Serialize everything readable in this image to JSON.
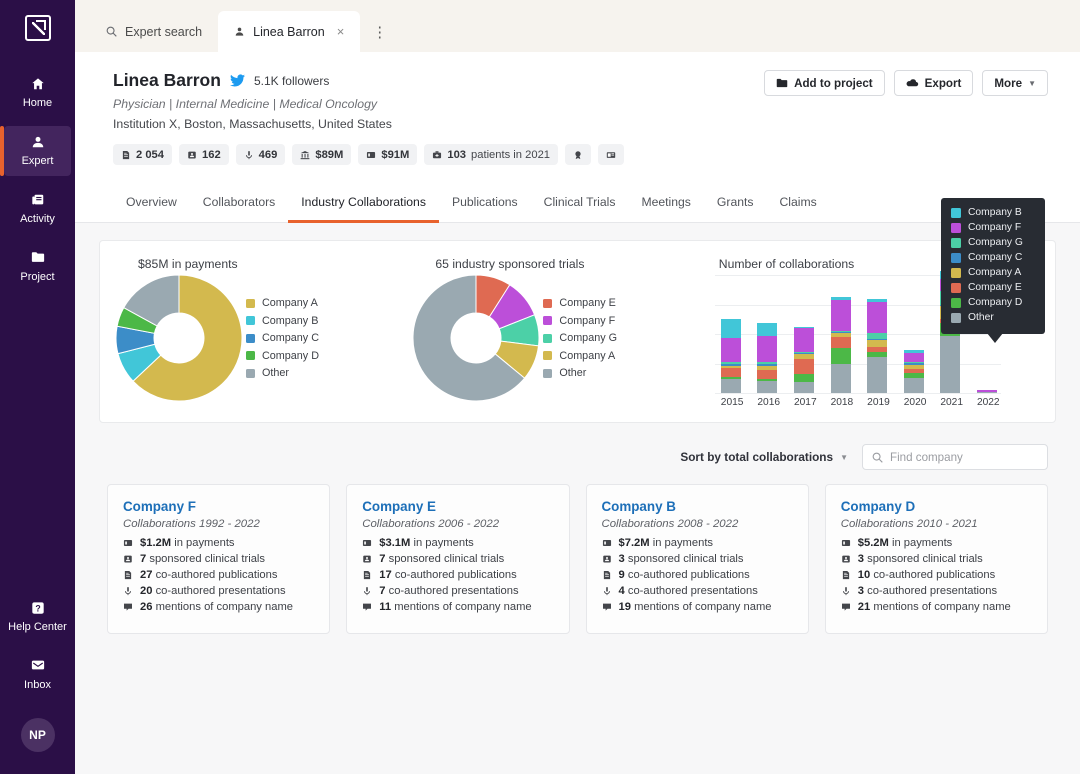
{
  "sidebar": {
    "logo_icon": "arrow-box-logo-icon",
    "items": [
      {
        "label": "Home",
        "icon": "home-icon",
        "active": false
      },
      {
        "label": "Expert",
        "icon": "person-icon",
        "active": true
      },
      {
        "label": "Activity",
        "icon": "activity-cards-icon",
        "active": false
      },
      {
        "label": "Project",
        "icon": "folder-icon",
        "active": false
      }
    ],
    "bottom_items": [
      {
        "label": "Help Center",
        "icon": "help-question-icon"
      },
      {
        "label": "Inbox",
        "icon": "inbox-envelope-icon"
      }
    ],
    "avatar_initials": "NP"
  },
  "window_tabs": [
    {
      "label": "Expert search",
      "icon": "search-icon",
      "active": false,
      "closable": false
    },
    {
      "label": "Linea Barron",
      "icon": "person-icon",
      "active": true,
      "closable": true
    }
  ],
  "window_tabs_more_icon": "kebab-menu-icon",
  "header": {
    "name": "Linea Barron",
    "twitter_icon": "twitter-bird-icon",
    "followers": "5.1K followers",
    "specialties": "Physician | Internal Medicine | Medical Oncology",
    "affiliation": "Institution X, Boston, Massachusetts, United States",
    "chips": [
      {
        "icon": "publications-icon",
        "value": "2 054",
        "suffix": ""
      },
      {
        "icon": "trials-icon",
        "value": "162",
        "suffix": ""
      },
      {
        "icon": "presentations-icon",
        "value": "469",
        "suffix": ""
      },
      {
        "icon": "grants-bank-icon",
        "value": "$89M",
        "suffix": ""
      },
      {
        "icon": "payments-icon",
        "value": "$91M",
        "suffix": ""
      },
      {
        "icon": "patients-icon",
        "value": "103",
        "suffix": "patients in 2021"
      },
      {
        "icon": "award-icon",
        "value": "",
        "suffix": ""
      },
      {
        "icon": "news-icon",
        "value": "",
        "suffix": ""
      }
    ],
    "actions": [
      {
        "label": "Add to project",
        "icon": "folder-plus-icon",
        "caret": false
      },
      {
        "label": "Export",
        "icon": "cloud-download-icon",
        "caret": false
      },
      {
        "label": "More",
        "icon": "",
        "caret": true
      }
    ]
  },
  "section_tabs": [
    {
      "label": "Overview",
      "active": false
    },
    {
      "label": "Collaborators",
      "active": false
    },
    {
      "label": "Industry Collaborations",
      "active": true
    },
    {
      "label": "Publications",
      "active": false
    },
    {
      "label": "Clinical Trials",
      "active": false
    },
    {
      "label": "Meetings",
      "active": false
    },
    {
      "label": "Grants",
      "active": false
    },
    {
      "label": "Claims",
      "active": false
    }
  ],
  "colors": {
    "company_a": "#d3b94e",
    "company_b": "#41c6d8",
    "company_c": "#3c8dc8",
    "company_d": "#4cb847",
    "company_e": "#df6a52",
    "company_f": "#bc4fd9",
    "company_g": "#4cd0a7",
    "other": "#9aa9b1",
    "accent": "#e8622d",
    "sidebar_bg": "#2b0f47",
    "link": "#1d6fb8"
  },
  "chart_data": [
    {
      "type": "pie",
      "title": "$85M in payments",
      "labels": [
        "Company A",
        "Company B",
        "Company C",
        "Company D",
        "Other"
      ],
      "values": [
        63,
        8,
        7,
        5,
        17
      ],
      "colors": [
        "#d3b94e",
        "#41c6d8",
        "#3c8dc8",
        "#4cb847",
        "#9aa9b1"
      ],
      "legend_position": "right",
      "donut": true
    },
    {
      "type": "pie",
      "title": "65 industry sponsored trials",
      "labels": [
        "Company E",
        "Company F",
        "Company G",
        "Company A",
        "Other"
      ],
      "values": [
        9,
        10,
        8,
        9,
        64
      ],
      "colors": [
        "#df6a52",
        "#bc4fd9",
        "#4cd0a7",
        "#d3b94e",
        "#9aa9b1"
      ],
      "legend_position": "right",
      "donut": true
    },
    {
      "type": "bar",
      "title": "Number of collaborations",
      "stacked": true,
      "xlabel": "",
      "ylabel": "",
      "ylim": [
        0,
        220
      ],
      "max_label": "220",
      "grid": true,
      "categories": [
        "2015",
        "2016",
        "2017",
        "2018",
        "2019",
        "2020",
        "2021",
        "2022"
      ],
      "series": [
        {
          "name": "Other",
          "color": "#9aa9b1",
          "values": [
            26,
            22,
            20,
            54,
            68,
            28,
            106,
            2
          ]
        },
        {
          "name": "Company D",
          "color": "#4cb847",
          "values": [
            4,
            4,
            16,
            30,
            8,
            10,
            24,
            0
          ]
        },
        {
          "name": "Company E",
          "color": "#df6a52",
          "values": [
            16,
            16,
            28,
            20,
            10,
            6,
            8,
            0
          ]
        },
        {
          "name": "Company A",
          "color": "#d3b94e",
          "values": [
            4,
            8,
            8,
            8,
            12,
            8,
            24,
            0
          ]
        },
        {
          "name": "Company C",
          "color": "#3c8dc8",
          "values": [
            4,
            4,
            2,
            2,
            2,
            4,
            2,
            0
          ]
        },
        {
          "name": "Company G",
          "color": "#4cd0a7",
          "values": [
            4,
            4,
            2,
            2,
            12,
            2,
            26,
            0
          ]
        },
        {
          "name": "Company F",
          "color": "#bc4fd9",
          "values": [
            44,
            48,
            46,
            58,
            58,
            16,
            22,
            4
          ]
        },
        {
          "name": "Company B",
          "color": "#41c6d8",
          "values": [
            36,
            24,
            2,
            6,
            6,
            6,
            16,
            0
          ]
        }
      ]
    }
  ],
  "tooltip": {
    "items": [
      {
        "label": "Company B",
        "color": "#41c6d8"
      },
      {
        "label": "Company F",
        "color": "#bc4fd9"
      },
      {
        "label": "Company G",
        "color": "#4cd0a7"
      },
      {
        "label": "Company C",
        "color": "#3c8dc8"
      },
      {
        "label": "Company A",
        "color": "#d3b94e"
      },
      {
        "label": "Company E",
        "color": "#df6a52"
      },
      {
        "label": "Company D",
        "color": "#4cb847"
      },
      {
        "label": "Other",
        "color": "#9aa9b1"
      }
    ]
  },
  "toolbar": {
    "sort_label": "Sort by total collaborations",
    "find_placeholder": "Find company",
    "find_value": ""
  },
  "company_cards": [
    {
      "name": "Company F",
      "years": "Collaborations 1992 - 2022",
      "stats": [
        {
          "icon": "payments-icon",
          "value": "$1.2M",
          "text": "in payments"
        },
        {
          "icon": "trials-icon",
          "value": "7",
          "text": "sponsored clinical trials"
        },
        {
          "icon": "publications-icon",
          "value": "27",
          "text": "co-authored publications"
        },
        {
          "icon": "presentations-icon",
          "value": "20",
          "text": "co-authored presentations"
        },
        {
          "icon": "mentions-icon",
          "value": "26",
          "text": "mentions of company name"
        }
      ]
    },
    {
      "name": "Company E",
      "years": "Collaborations 2006 - 2022",
      "stats": [
        {
          "icon": "payments-icon",
          "value": "$3.1M",
          "text": "in payments"
        },
        {
          "icon": "trials-icon",
          "value": "7",
          "text": "sponsored clinical trials"
        },
        {
          "icon": "publications-icon",
          "value": "17",
          "text": "co-authored publications"
        },
        {
          "icon": "presentations-icon",
          "value": "7",
          "text": "co-authored presentations"
        },
        {
          "icon": "mentions-icon",
          "value": "11",
          "text": "mentions of company name"
        }
      ]
    },
    {
      "name": "Company B",
      "years": "Collaborations 2008 - 2022",
      "stats": [
        {
          "icon": "payments-icon",
          "value": "$7.2M",
          "text": "in payments"
        },
        {
          "icon": "trials-icon",
          "value": "3",
          "text": "sponsored clinical trials"
        },
        {
          "icon": "publications-icon",
          "value": "9",
          "text": "co-authored publications"
        },
        {
          "icon": "presentations-icon",
          "value": "4",
          "text": "co-authored presentations"
        },
        {
          "icon": "mentions-icon",
          "value": "19",
          "text": "mentions of company name"
        }
      ]
    },
    {
      "name": "Company D",
      "years": "Collaborations 2010 - 2021",
      "stats": [
        {
          "icon": "payments-icon",
          "value": "$5.2M",
          "text": "in payments"
        },
        {
          "icon": "trials-icon",
          "value": "3",
          "text": "sponsored clinical trials"
        },
        {
          "icon": "publications-icon",
          "value": "10",
          "text": "co-authored publications"
        },
        {
          "icon": "presentations-icon",
          "value": "3",
          "text": "co-authored presentations"
        },
        {
          "icon": "mentions-icon",
          "value": "21",
          "text": "mentions of company name"
        }
      ]
    }
  ]
}
